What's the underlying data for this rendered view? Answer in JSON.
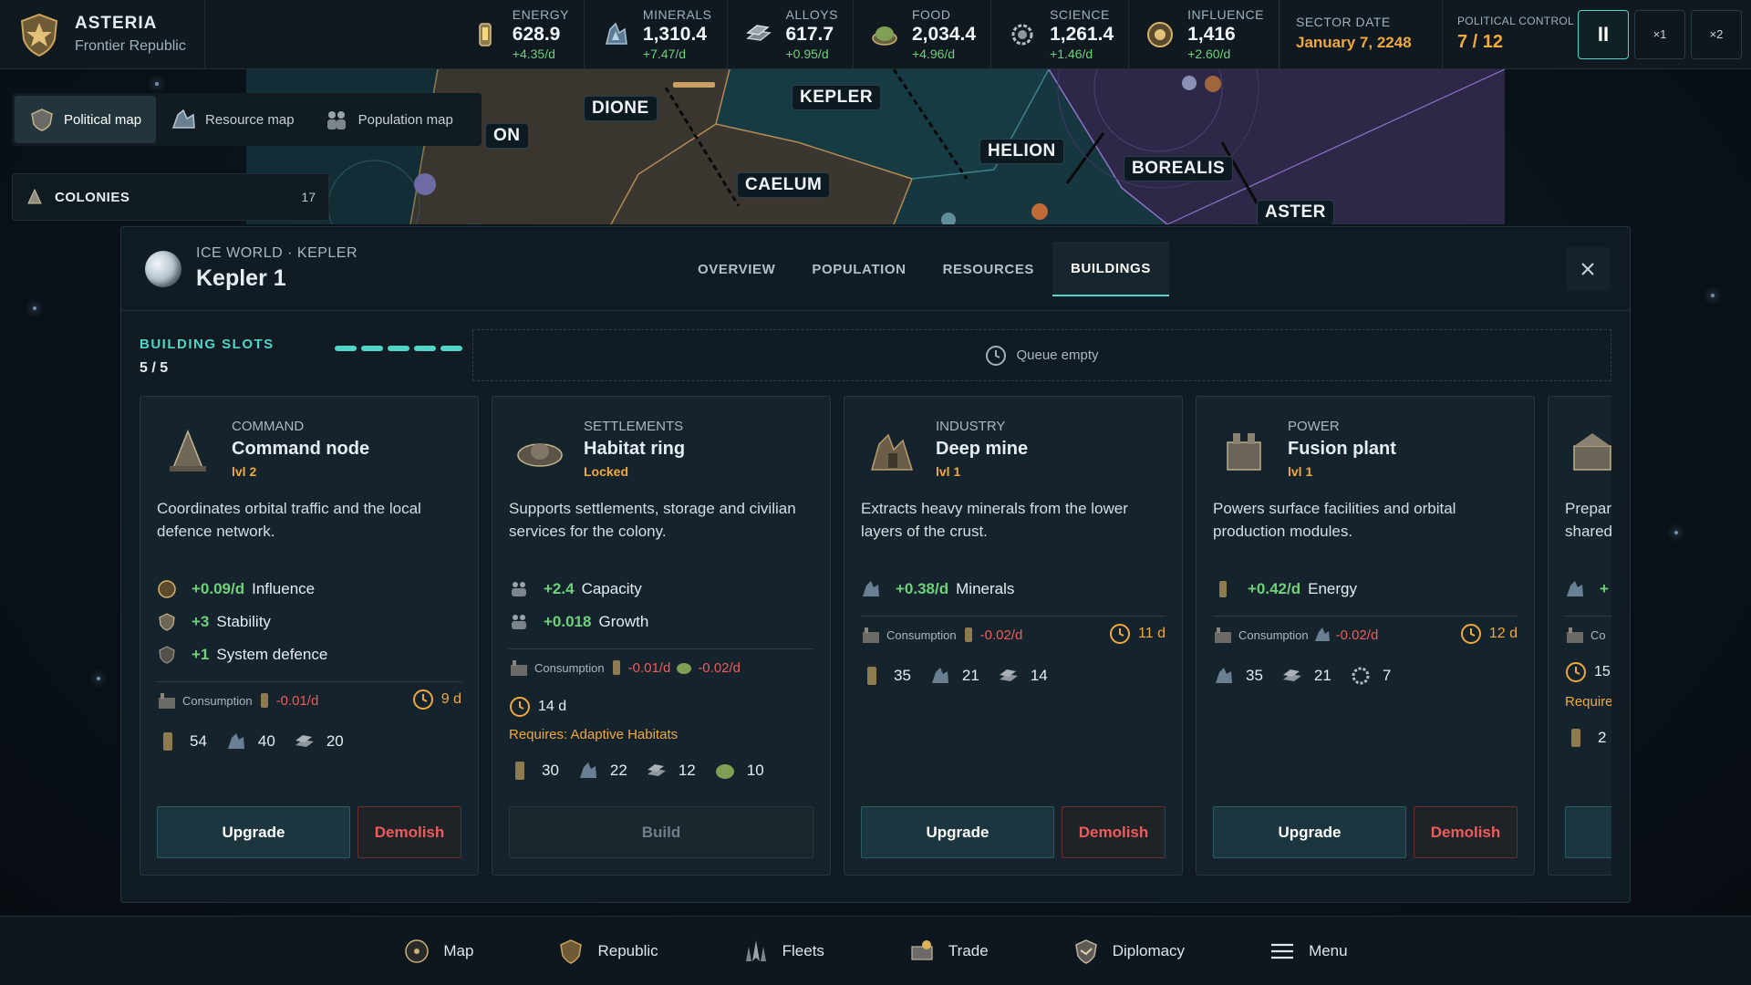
{
  "empire": {
    "name": "ASTERIA",
    "government": "Frontier Republic"
  },
  "resources": [
    {
      "name": "ENERGY",
      "value": "628.9",
      "rate": "+4.35/d",
      "icon": "energy-icon"
    },
    {
      "name": "MINERALS",
      "value": "1,310.4",
      "rate": "+7.47/d",
      "icon": "minerals-icon"
    },
    {
      "name": "ALLOYS",
      "value": "617.7",
      "rate": "+0.95/d",
      "icon": "alloys-icon"
    },
    {
      "name": "FOOD",
      "value": "2,034.4",
      "rate": "+4.96/d",
      "icon": "food-icon"
    },
    {
      "name": "SCIENCE",
      "value": "1,261.4",
      "rate": "+1.46/d",
      "icon": "science-icon"
    },
    {
      "name": "INFLUENCE",
      "value": "1,416",
      "rate": "+2.60/d",
      "icon": "influence-icon"
    }
  ],
  "sector_date": {
    "label": "SECTOR DATE",
    "value": "January 7, 2248"
  },
  "political_control": {
    "label": "POLITICAL CONTROL",
    "value": "7 / 12"
  },
  "speed": {
    "pause": "II",
    "x1": "×1",
    "x2": "×2"
  },
  "map_modes": [
    "Political map",
    "Resource map",
    "Population map"
  ],
  "colonies": {
    "label": "COLONIES",
    "count": "17"
  },
  "systems": [
    "ON",
    "DIONE",
    "KEPLER",
    "CAELUM",
    "HELION",
    "BOREALIS",
    "ASTER"
  ],
  "panel": {
    "subtitle": "ICE WORLD · KEPLER",
    "title": "Kepler 1",
    "tabs": [
      "OVERVIEW",
      "POPULATION",
      "RESOURCES",
      "BUILDINGS"
    ],
    "active_tab": "BUILDINGS",
    "slots_label": "BUILDING SLOTS",
    "slots_count": "5 / 5",
    "slots_used": 5,
    "queue": "Queue empty"
  },
  "buildings": [
    {
      "category": "COMMAND",
      "name": "Command node",
      "level": "lvl 2",
      "description": "Coordinates orbital traffic and the local defence network.",
      "effects": [
        {
          "value": "+0.09/d",
          "label": "Influence"
        },
        {
          "value": "+3",
          "label": "Stability"
        },
        {
          "value": "+1",
          "label": "System defence"
        }
      ],
      "consumption_label": "Consumption",
      "consumption": [
        "-0.01/d"
      ],
      "time": "9 d",
      "costs": [
        "54",
        "40",
        "20"
      ],
      "primary": "Upgrade",
      "secondary": "Demolish"
    },
    {
      "category": "SETTLEMENTS",
      "name": "Habitat ring",
      "level": "Locked",
      "description": "Supports settlements, storage and civilian services for the colony.",
      "effects": [
        {
          "value": "+2.4",
          "label": "Capacity"
        },
        {
          "value": "+0.018",
          "label": "Growth"
        }
      ],
      "consumption_label": "Consumption",
      "consumption": [
        "-0.01/d",
        "-0.02/d"
      ],
      "time": "14 d",
      "requires": "Requires: Adaptive Habitats",
      "costs": [
        "30",
        "22",
        "12",
        "10"
      ],
      "primary": "Build"
    },
    {
      "category": "INDUSTRY",
      "name": "Deep mine",
      "level": "lvl 1",
      "description": "Extracts heavy minerals from the lower layers of the crust.",
      "effects": [
        {
          "value": "+0.38/d",
          "label": "Minerals"
        }
      ],
      "consumption_label": "Consumption",
      "consumption": [
        "-0.02/d"
      ],
      "time": "11 d",
      "costs": [
        "35",
        "21",
        "14"
      ],
      "primary": "Upgrade",
      "secondary": "Demolish"
    },
    {
      "category": "POWER",
      "name": "Fusion plant",
      "level": "lvl 1",
      "description": "Powers surface facilities and orbital production modules.",
      "effects": [
        {
          "value": "+0.42/d",
          "label": "Energy"
        }
      ],
      "consumption_label": "Consumption",
      "consumption": [
        "-0.02/d"
      ],
      "time": "12 d",
      "costs": [
        "35",
        "21",
        "7"
      ],
      "primary": "Upgrade",
      "secondary": "Demolish"
    },
    {
      "partial": true,
      "desc_lines": [
        "Prepar",
        "shared"
      ],
      "effect": "+",
      "consumption_label": "Co",
      "time": "15",
      "requires": "Require",
      "cost": "2"
    }
  ],
  "nav": [
    "Map",
    "Republic",
    "Fleets",
    "Trade",
    "Diplomacy",
    "Menu"
  ],
  "colors": {
    "accent": "#4fd6c6",
    "gold": "#f0a93d",
    "positive": "#6fd07b",
    "negative": "#ef5b5b"
  }
}
